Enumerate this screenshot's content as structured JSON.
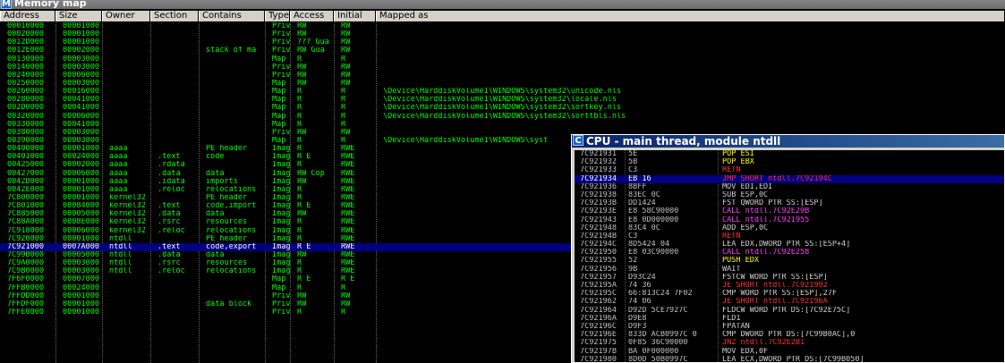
{
  "memory_map": {
    "title": "Memory map",
    "title_icon": "M",
    "columns": [
      "Address",
      "Size",
      "Owner",
      "Section",
      "Contains",
      "Type",
      "Access",
      "Initial",
      "Mapped as"
    ],
    "rows": [
      [
        "00010000",
        "00001000",
        "",
        "",
        "",
        "Priv",
        "RW",
        "RW",
        ""
      ],
      [
        "00020000",
        "00001000",
        "",
        "",
        "",
        "Priv",
        "RW",
        "RW",
        ""
      ],
      [
        "0012D000",
        "00001000",
        "",
        "",
        "",
        "Priv",
        "??? Gua",
        "RW",
        ""
      ],
      [
        "0012E000",
        "00002000",
        "",
        "",
        "stack of ma",
        "Priv",
        "RW Gua",
        "RW",
        ""
      ],
      [
        "00130000",
        "00003000",
        "",
        "",
        "",
        "Map",
        "R",
        "R",
        ""
      ],
      [
        "00140000",
        "00003000",
        "",
        "",
        "",
        "Priv",
        "RW",
        "RW",
        ""
      ],
      [
        "00240000",
        "00006000",
        "",
        "",
        "",
        "Priv",
        "RW",
        "RW",
        ""
      ],
      [
        "00250000",
        "00003000",
        "",
        "",
        "",
        "Map",
        "RW",
        "RW",
        ""
      ],
      [
        "00260000",
        "00016000",
        "",
        "",
        "",
        "Map",
        "R",
        "R",
        "\\Device\\HarddiskVolume1\\WINDOWS\\system32\\unicode.nls"
      ],
      [
        "00280000",
        "00041000",
        "",
        "",
        "",
        "Map",
        "R",
        "R",
        "\\Device\\HarddiskVolume1\\WINDOWS\\system32\\locale.nls"
      ],
      [
        "002D0000",
        "00041000",
        "",
        "",
        "",
        "Map",
        "R",
        "R",
        "\\Device\\HarddiskVolume1\\WINDOWS\\system32\\sortkey.nls"
      ],
      [
        "00320000",
        "00006000",
        "",
        "",
        "",
        "Map",
        "R",
        "R",
        "\\Device\\HarddiskVolume1\\WINDOWS\\system32\\sorttbls.nls"
      ],
      [
        "00330000",
        "00041000",
        "",
        "",
        "",
        "Map",
        "R",
        "R",
        ""
      ],
      [
        "00380000",
        "00003000",
        "",
        "",
        "",
        "Priv",
        "RW",
        "RW",
        ""
      ],
      [
        "00390000",
        "00003000",
        "",
        "",
        "",
        "Map",
        "R",
        "R",
        "\\Device\\HarddiskVolume1\\WINDOWS\\syst"
      ],
      [
        "00400000",
        "00001000",
        "aaaa",
        "",
        "PE header",
        "Imag",
        "R",
        "RWE",
        ""
      ],
      [
        "00401000",
        "00024000",
        "aaaa",
        ".text",
        "code",
        "Imag",
        "R E",
        "RWE",
        ""
      ],
      [
        "00425000",
        "00002000",
        "aaaa",
        ".rdata",
        "",
        "Imag",
        "R",
        "RWE",
        ""
      ],
      [
        "00427000",
        "00006000",
        "aaaa",
        ".data",
        "data",
        "Imag",
        "RW Cop",
        "RWE",
        ""
      ],
      [
        "0042D000",
        "00001000",
        "aaaa",
        ".idata",
        "imports",
        "Imag",
        "RW",
        "RWE",
        ""
      ],
      [
        "0042E000",
        "00001000",
        "aaaa",
        ".reloc",
        "relocations",
        "Imag",
        "R",
        "RWE",
        ""
      ],
      [
        "7C800000",
        "00001000",
        "kernel32",
        "",
        "PE header",
        "Imag",
        "R",
        "RWE",
        ""
      ],
      [
        "7C801000",
        "00084000",
        "kernel32",
        ".text",
        "code,import",
        "Imag",
        "R E",
        "RWE",
        ""
      ],
      [
        "7C885000",
        "00005000",
        "kernel32",
        ".data",
        "data",
        "Imag",
        "RW",
        "RWE",
        ""
      ],
      [
        "7C88A000",
        "0008E000",
        "kernel32",
        ".rsrc",
        "resources",
        "Imag",
        "R",
        "RWE",
        ""
      ],
      [
        "7C918000",
        "00006000",
        "kernel32",
        ".reloc",
        "relocations",
        "Imag",
        "R",
        "RWE",
        ""
      ],
      [
        "7C920000",
        "00001000",
        "ntdll",
        "",
        "PE header",
        "Imag",
        "R",
        "RWE",
        ""
      ],
      [
        "7C921000",
        "0007A000",
        "ntdll",
        ".text",
        "code,export",
        "Imag",
        "R E",
        "RWE",
        ""
      ],
      [
        "7C99B000",
        "00005000",
        "ntdll",
        ".data",
        "data",
        "Imag",
        "RW",
        "RWE",
        ""
      ],
      [
        "7C9A0000",
        "00003000",
        "ntdll",
        ".rsrc",
        "resources",
        "Imag",
        "R",
        "RWE",
        ""
      ],
      [
        "7C9B0000",
        "00003000",
        "ntdll",
        ".reloc",
        "relocations",
        "Imag",
        "R",
        "RWE",
        ""
      ],
      [
        "7F6F0000",
        "00007000",
        "",
        "",
        "",
        "Map",
        "R E",
        "R E",
        ""
      ],
      [
        "7FFB0000",
        "00024000",
        "",
        "",
        "",
        "Map",
        "R",
        "R",
        ""
      ],
      [
        "7FFDD000",
        "00001000",
        "",
        "",
        "",
        "Priv",
        "RW",
        "RW",
        ""
      ],
      [
        "7FFDF000",
        "00001000",
        "",
        "",
        "data block",
        "Priv",
        "RW",
        "RW",
        ""
      ],
      [
        "7FFE0000",
        "00001000",
        "",
        "",
        "",
        "Priv",
        "R",
        "R",
        ""
      ]
    ],
    "selected_row": 27
  },
  "cpu": {
    "title": "CPU - main thread, module ntdll",
    "title_icon": "C",
    "selected_row": 3,
    "rows": [
      [
        "7C921931",
        "5E",
        "POP ESI"
      ],
      [
        "7C921932",
        "5B",
        "POP EBX"
      ],
      [
        "7C921933",
        "C3",
        "RETN"
      ],
      [
        "7C921934",
        "EB 16",
        "JMP SHORT ntdll.7C92194C"
      ],
      [
        "7C921936",
        "8BFF",
        "MOV EDI,EDI"
      ],
      [
        "7C921938",
        "83EC 0C",
        "SUB ESP,0C"
      ],
      [
        "7C92193B",
        "DD1424",
        "FST QWORD PTR SS:[ESP]"
      ],
      [
        "7C92193E",
        "E8 58C90000",
        "CALL ntdll.7C92E29B"
      ],
      [
        "7C921943",
        "E8 0D000000",
        "CALL ntdll.7C921955"
      ],
      [
        "7C921948",
        "83C4 0C",
        "ADD ESP,0C"
      ],
      [
        "7C92194B",
        "C3",
        "RETN"
      ],
      [
        "7C92194C",
        "8D5424 04",
        "LEA EDX,DWORD PTR SS:[ESP+4]"
      ],
      [
        "7C921950",
        "E8 03C90000",
        "CALL ntdll.7C92E258"
      ],
      [
        "7C921955",
        "52",
        "PUSH EDX"
      ],
      [
        "7C921956",
        "9B",
        "WAIT"
      ],
      [
        "7C921957",
        "D93C24",
        "FSTCW WORD PTR SS:[ESP]"
      ],
      [
        "7C92195A",
        "74 36",
        "JE SHORT ntdll.7C921992"
      ],
      [
        "7C92195C",
        "66:813C24 7F02",
        "CMP WORD PTR SS:[ESP],27F"
      ],
      [
        "7C921962",
        "74 06",
        "JE SHORT ntdll.7C92196A"
      ],
      [
        "7C921964",
        "D92D 5CE7927C",
        "FLDCW WORD PTR DS:[7C92E75C]"
      ],
      [
        "7C92196A",
        "D9E8",
        "FLD1"
      ],
      [
        "7C92196C",
        "D9F3",
        "FPATAN"
      ],
      [
        "7C92196E",
        "833D ACB0997C 0",
        "CMP DWORD PTR DS:[7C99B0AC],0"
      ],
      [
        "7C921975",
        "0F85 36C90000",
        "JNZ ntdll.7C92E2B1"
      ],
      [
        "7C92197B",
        "BA 0F000000",
        "MOV EDX,0F"
      ],
      [
        "7C921980",
        "8D0D 50B0997C",
        "LEA ECX,DWORD PTR DS:[7C99B050]"
      ]
    ]
  },
  "colors": {
    "memory_text": "#00ff00",
    "selection": "#000080",
    "mnemonic": "#ffff00",
    "jump": "#ff3030",
    "call": "#ff40ff"
  }
}
